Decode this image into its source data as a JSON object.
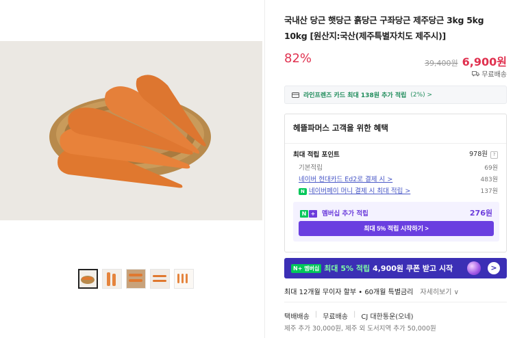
{
  "product": {
    "title": "국내산 당근 햇당근 흙당근 구좌당근 제주당근 3kg 5kg 10kg [원산지:국산(제주특별자치도 제주시)]",
    "discount": "82%",
    "original_price": "39,400원",
    "sale_price": "6,900원",
    "shipping": "무료배송"
  },
  "card_benefit": {
    "text": "라인프렌즈 카드 최대 138원 추가 적립",
    "percent": "(2%) >"
  },
  "benefits": {
    "title": "헤뜰파머스 고객을 위한 혜택",
    "max_points_label": "최대 적립 포인트",
    "max_points_value": "978원",
    "help": "?",
    "rows": [
      {
        "label": "기본적립",
        "value": "69원"
      },
      {
        "label": "네이버 현대카드 Ed2로 결제 시 >",
        "value": "483원"
      },
      {
        "label": "네이버페이 머니 결제 시 최대 적립 >",
        "value": "137원",
        "badge": "N"
      }
    ],
    "member": {
      "tag_n": "N",
      "tag_plus": "+",
      "label": "멤버십 추가 적립",
      "value": "276원",
      "button": "최대 5% 적립 시작하기 >"
    }
  },
  "banner": {
    "badge": "N+ 멤버십",
    "accent": "최대 5% 적립",
    "text": "4,900원 쿠폰 받고 시작",
    "arrow": ">"
  },
  "installment": {
    "text": "최대 12개월 무이자 할부 • 60개월 특별금리",
    "more": "자세히보기 ∨"
  },
  "delivery": {
    "type": "택배배송",
    "fee": "무료배송",
    "carrier": "CJ 대한통운(오네)",
    "extra": "제주 추가 30,000원, 제주 외 도서지역 추가 50,000원"
  },
  "colors": {
    "sale_red": "#e0314f",
    "naver_green": "#03c75a",
    "membership_purple": "#6a3fe0",
    "banner_bg": "#3b2fb5"
  }
}
